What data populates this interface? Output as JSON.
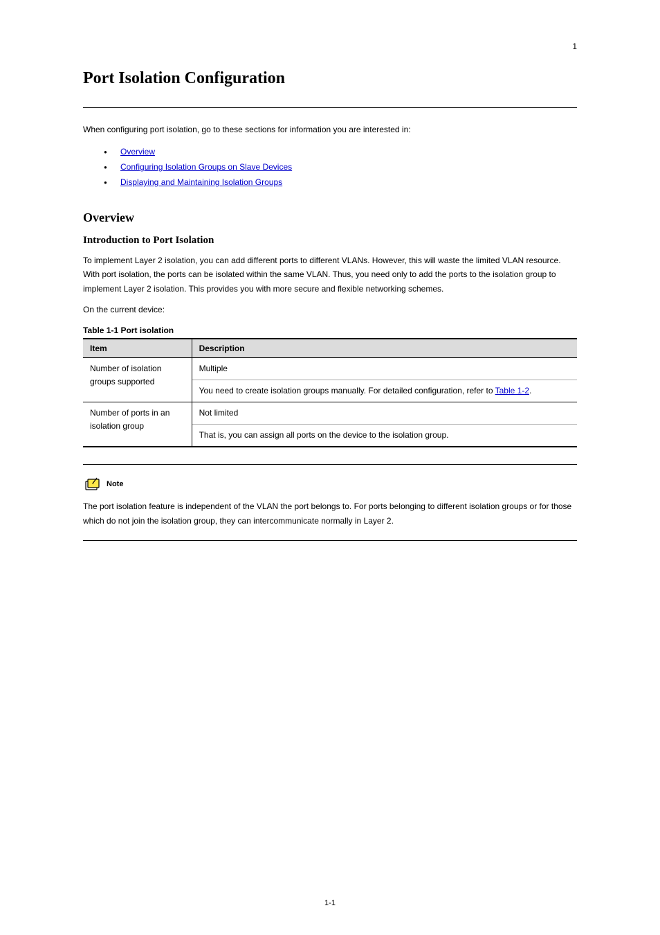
{
  "page_number_top": "1",
  "chapter_title": "Port Isolation Configuration",
  "intro_line": "When configuring port isolation, go to these sections for information you are interested in:",
  "toc": [
    "Overview",
    "Configuring Isolation Groups on Slave Devices",
    "Displaying and Maintaining Isolation Groups"
  ],
  "section_overview": "Overview",
  "subsection_intro": "Introduction to Port Isolation",
  "para1": "To implement Layer 2 isolation, you can add different ports to different VLANs. However, this will waste the limited VLAN resource. With port isolation, the ports can be isolated within the same VLAN. Thus, you need only to add the ports to the isolation group to implement Layer 2 isolation. This provides you with more secure and flexible networking schemes.",
  "para2": "On the current device:",
  "table_caption": "Table 1-1 Port isolation",
  "table": {
    "headers": [
      "Item",
      "Description"
    ],
    "rows": [
      {
        "item": "Number of isolation groups supported",
        "desc_lines": [
          "Multiple",
          "You need to create isolation groups manually. For detailed configuration, refer to <a>Table 1-2</a>."
        ],
        "link_text": "Table 1-2"
      },
      {
        "item": "Number of ports in an isolation group",
        "desc_lines": [
          "Not limited",
          "That is, you can assign all ports on the device to the isolation group."
        ]
      }
    ]
  },
  "note_label": "Note",
  "note_body": "The port isolation feature is independent of the VLAN the port belongs to. For ports belonging to different isolation groups or for those which do not join the isolation group, they can intercommunicate normally in Layer 2.",
  "page_number_bottom": "1-1"
}
